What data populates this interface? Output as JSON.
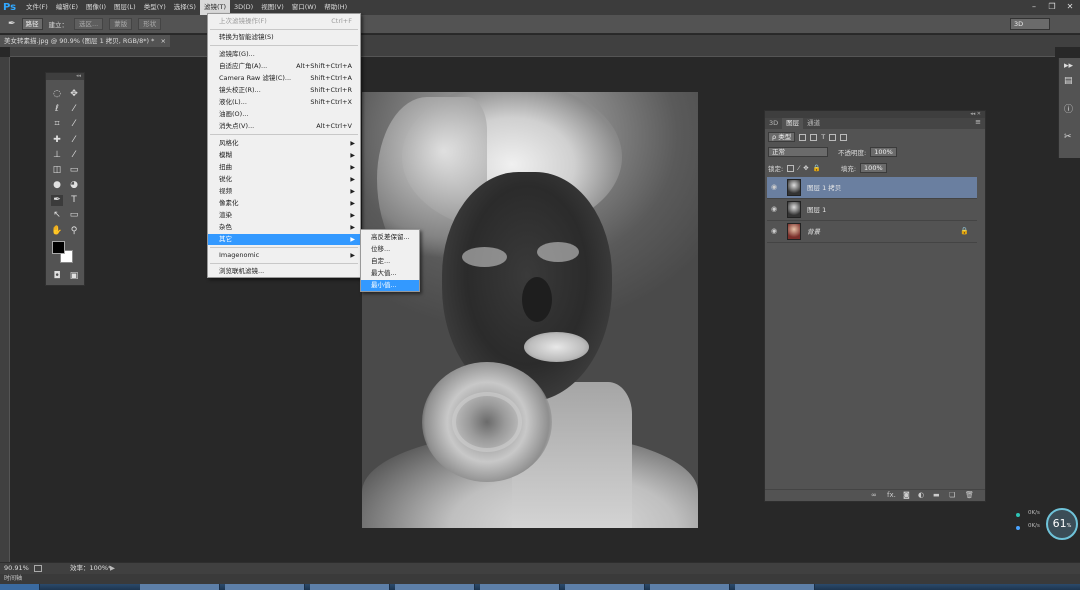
{
  "app": {
    "logo": "Ps",
    "menus": [
      "文件(F)",
      "编辑(E)",
      "图像(I)",
      "图层(L)",
      "类型(Y)",
      "选择(S)",
      "滤镜(T)",
      "3D(D)",
      "视图(V)",
      "窗口(W)",
      "帮助(H)"
    ],
    "active_menu_index": 6,
    "window_controls": [
      "minimize",
      "restore",
      "close"
    ]
  },
  "options_bar": {
    "tool_icon": "pen-icon",
    "mode_value": "路径",
    "make_label": "建立：",
    "selection_btn": "选区...",
    "mask_btn": "蒙版",
    "shape_btn": "形状",
    "autoadd_fragment": "边缘",
    "workspace_value": "3D"
  },
  "document": {
    "tab_title": "美女转素描.jpg @ 90.9% (图层 1 拷贝, RGB/8*) *",
    "close_label": "×"
  },
  "filter_menu": {
    "items": [
      {
        "label": "上次滤镜操作(F)",
        "shortcut": "Ctrl+F",
        "disabled": true
      },
      {
        "sep": true
      },
      {
        "label": "转换为智能滤镜(S)"
      },
      {
        "sep": true
      },
      {
        "label": "滤镜库(G)..."
      },
      {
        "label": "自适应广角(A)...",
        "shortcut": "Alt+Shift+Ctrl+A"
      },
      {
        "label": "Camera Raw 滤镜(C)...",
        "shortcut": "Shift+Ctrl+A"
      },
      {
        "label": "镜头校正(R)...",
        "shortcut": "Shift+Ctrl+R"
      },
      {
        "label": "液化(L)...",
        "shortcut": "Shift+Ctrl+X"
      },
      {
        "label": "油画(O)..."
      },
      {
        "label": "消失点(V)...",
        "shortcut": "Alt+Ctrl+V"
      },
      {
        "sep": true
      },
      {
        "label": "风格化",
        "submenu": true
      },
      {
        "label": "模糊",
        "submenu": true
      },
      {
        "label": "扭曲",
        "submenu": true
      },
      {
        "label": "锐化",
        "submenu": true
      },
      {
        "label": "视频",
        "submenu": true
      },
      {
        "label": "像素化",
        "submenu": true
      },
      {
        "label": "渲染",
        "submenu": true
      },
      {
        "label": "杂色",
        "submenu": true
      },
      {
        "label": "其它",
        "submenu": true,
        "highlighted": true
      },
      {
        "sep": true
      },
      {
        "label": "Imagenomic",
        "submenu": true
      },
      {
        "sep": true
      },
      {
        "label": "浏览联机滤镜..."
      }
    ]
  },
  "other_submenu": {
    "items": [
      {
        "label": "高反差保留..."
      },
      {
        "label": "位移..."
      },
      {
        "label": "自定..."
      },
      {
        "label": "最大值..."
      },
      {
        "label": "最小值...",
        "highlighted": true
      }
    ]
  },
  "layers_panel": {
    "tabs": [
      "3D",
      "图层",
      "通道"
    ],
    "active_tab": 1,
    "kind_filter": "ρ 类型",
    "blend_mode": "正常",
    "opacity_label": "不透明度:",
    "opacity_value": "100%",
    "lock_label": "锁定:",
    "fill_label": "填充:",
    "fill_value": "100%",
    "layers": [
      {
        "name": "图层 1 拷贝",
        "selected": true,
        "locked": false
      },
      {
        "name": "图层 1",
        "selected": false,
        "locked": false
      },
      {
        "name": "背景",
        "selected": false,
        "locked": true
      }
    ],
    "footer_icons": [
      "link-icon",
      "fx-icon",
      "mask-icon",
      "adjustment-icon",
      "folder-icon",
      "new-layer-icon",
      "trash-icon"
    ],
    "footer_fx_label": "fx."
  },
  "status": {
    "zoom": "90.91%",
    "efficiency": "效率：100%*",
    "timeline_label": "时间轴"
  },
  "speed_widget": {
    "percent": "61",
    "percent_unit": "%",
    "up_rate": "0K/s",
    "down_rate": "0K/s"
  },
  "colors": {
    "menu_highlight": "#3399ff",
    "layer_selected": "#6a7fa0",
    "panel_bg": "#535353",
    "canvas_bg": "#282828"
  }
}
